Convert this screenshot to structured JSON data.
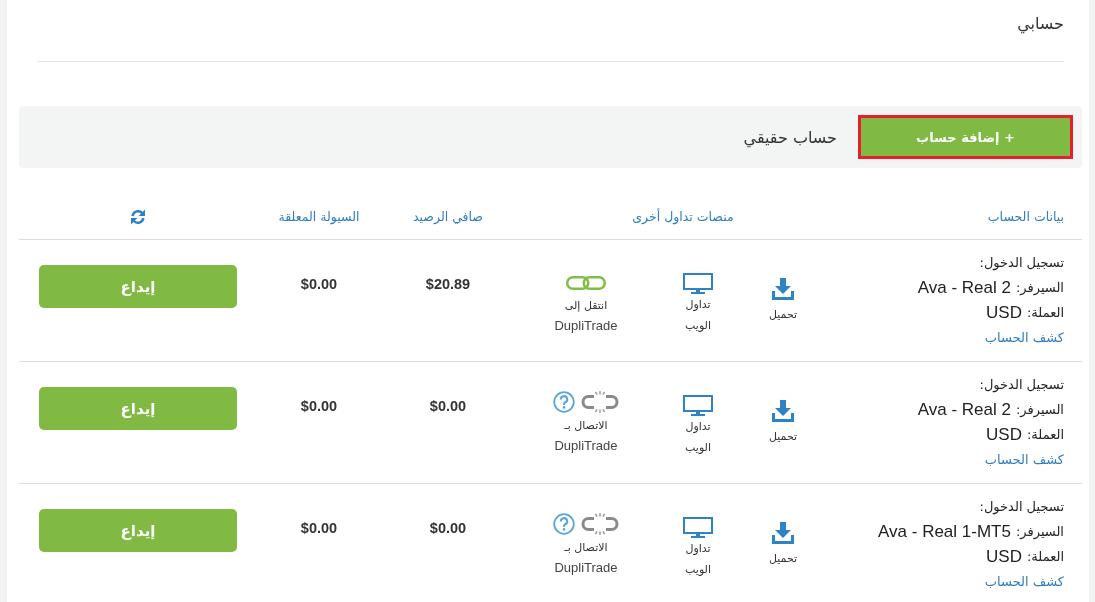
{
  "page_title": "حسابي",
  "account_panel": {
    "title": "حساب حقيقي",
    "add_button": {
      "label": "+ إضافة حساب",
      "highlighted": true
    }
  },
  "table": {
    "columns": [
      "بيانات الحساب",
      "منصات تداول أخرى",
      "صافي الرصيد",
      "السيولة المعلقة"
    ],
    "rows": [
      {
        "login_label": "تسجيل الدخول:",
        "server_label": "السيرفر:",
        "server": "Ava - Real 2",
        "currency_label": "العملة:",
        "currency": "USD",
        "statement_link": "كشف الحساب",
        "platforms": [
          {
            "kind": "download",
            "label": "تحميل"
          },
          {
            "kind": "web",
            "label": "تداول الويب"
          },
          {
            "kind": "duplitrade",
            "connected": true,
            "label": "انتقل إلى",
            "name": "DupliTrade"
          }
        ],
        "net_balance": "$20.89",
        "pending_liquidity": "$0.00",
        "deposit_button": "إيداع"
      },
      {
        "login_label": "تسجيل الدخول:",
        "server_label": "السيرفر:",
        "server": "Ava - Real 2",
        "currency_label": "العملة:",
        "currency": "USD",
        "statement_link": "كشف الحساب",
        "platforms": [
          {
            "kind": "download",
            "label": "تحميل"
          },
          {
            "kind": "web",
            "label": "تداول الويب"
          },
          {
            "kind": "duplitrade",
            "connected": false,
            "label": "الاتصال بـ",
            "name": "DupliTrade"
          }
        ],
        "net_balance": "$0.00",
        "pending_liquidity": "$0.00",
        "deposit_button": "إيداع"
      },
      {
        "login_label": "تسجيل الدخول:",
        "server_label": "السيرفر:",
        "server": "Ava - Real 1-MT5",
        "currency_label": "العملة:",
        "currency": "USD",
        "statement_link": "كشف الحساب",
        "platforms": [
          {
            "kind": "download",
            "label": "تحميل"
          },
          {
            "kind": "web",
            "label": "تداول الويب"
          },
          {
            "kind": "duplitrade",
            "connected": false,
            "label": "الاتصال بـ",
            "name": "DupliTrade"
          }
        ],
        "net_balance": "$0.00",
        "pending_liquidity": "$0.00",
        "deposit_button": "إيداع"
      }
    ]
  }
}
